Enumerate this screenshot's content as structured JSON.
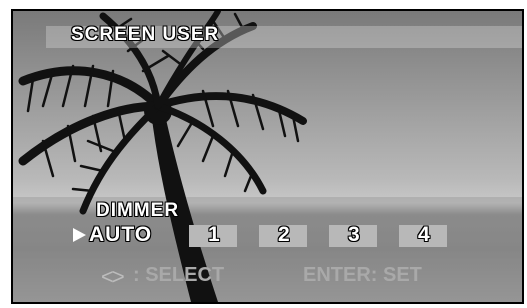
{
  "menu": {
    "title": "SCREEN USER",
    "dimmer": {
      "label": "DIMMER",
      "options": [
        "AUTO",
        "1",
        "2",
        "3",
        "4"
      ],
      "selected": "AUTO"
    },
    "hints": {
      "arrows": "<>",
      "select": ": SELECT",
      "set": "ENTER: SET"
    }
  },
  "colors": {
    "text": "#ffffff",
    "hint_text": "#a9a9a9",
    "option_box": "#b8b8b8"
  },
  "icons": {
    "cursor": "right-triangle-icon",
    "background": "palm-tree-silhouette"
  }
}
